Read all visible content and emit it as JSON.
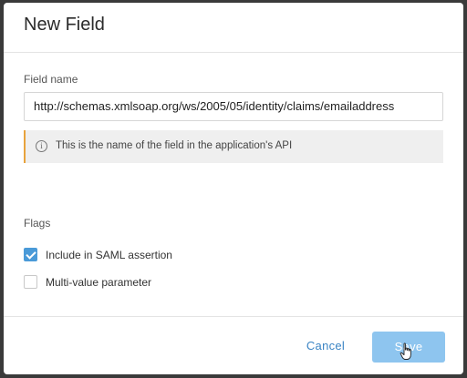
{
  "dialog": {
    "title": "New Field"
  },
  "field_name": {
    "label": "Field name",
    "value": "http://schemas.xmlsoap.org/ws/2005/05/identity/claims/emailaddress"
  },
  "info": {
    "icon": "info-icon",
    "text": "This is the name of the field in the application's API",
    "accent_color": "#e8a33d"
  },
  "flags": {
    "label": "Flags",
    "options": [
      {
        "label": "Include in SAML assertion",
        "checked": true
      },
      {
        "label": "Multi-value parameter",
        "checked": false
      }
    ],
    "checked_color": "#4a9ad8"
  },
  "footer": {
    "cancel_label": "Cancel",
    "save_label": "Save",
    "save_color": "#8ec5ef",
    "cancel_color": "#3a84c4"
  }
}
